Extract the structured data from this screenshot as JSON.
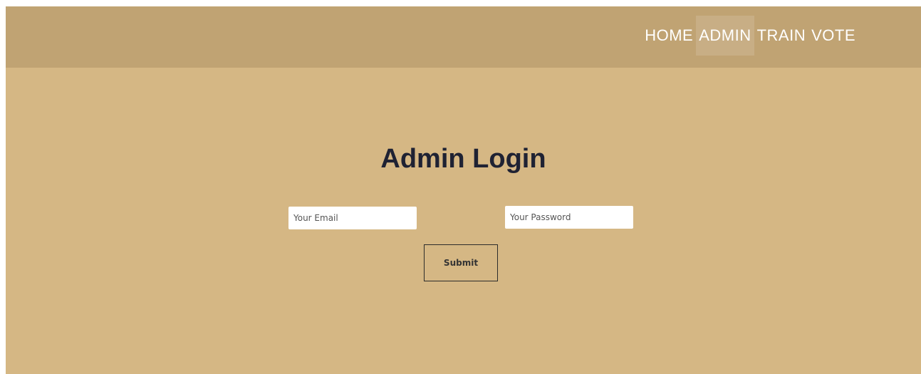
{
  "nav": {
    "items": [
      {
        "label": "HOME",
        "active": false
      },
      {
        "label": "ADMIN",
        "active": true
      },
      {
        "label": "TRAIN",
        "active": false
      },
      {
        "label": "VOTE",
        "active": false
      }
    ]
  },
  "login": {
    "title": "Admin Login",
    "email": {
      "placeholder": "Your Email",
      "value": ""
    },
    "password": {
      "placeholder": "Your Password",
      "value": ""
    },
    "submit_label": "Submit"
  },
  "colors": {
    "page_background": "#d5b784",
    "navbar_background": "#c0a373",
    "title_text": "#1f2233",
    "nav_text": "#ffffff"
  }
}
